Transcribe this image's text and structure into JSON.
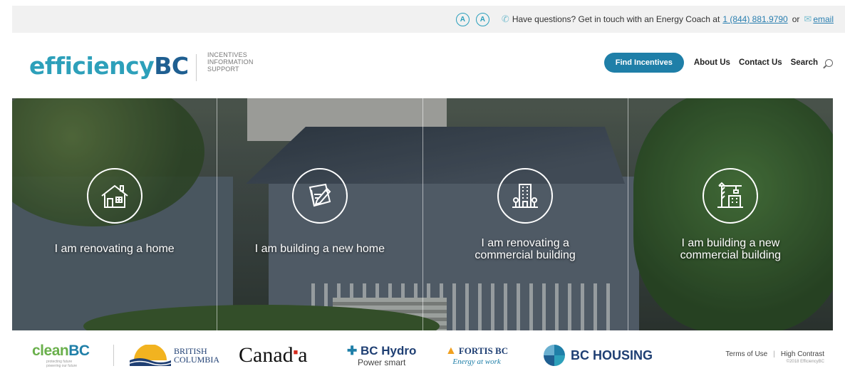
{
  "utility_bar": {
    "a11y_increase": "A",
    "a11y_decrease": "A",
    "question_text": "Have questions? Get in touch with an Energy Coach at",
    "phone": "1 (844) 881.9790",
    "or": "or",
    "email": "email"
  },
  "header": {
    "logo_part1": "efficiency",
    "logo_part2": "BC",
    "tagline": [
      "INCENTIVES",
      "INFORMATION",
      "SUPPORT"
    ],
    "nav": {
      "find_incentives": "Find Incentives",
      "about": "About Us",
      "contact": "Contact Us",
      "search": "Search"
    }
  },
  "hero": {
    "panels": [
      {
        "label": "I am renovating a home",
        "icon": "house-renovation-icon"
      },
      {
        "label": "I am building a new home",
        "icon": "blueprint-pencil-icon"
      },
      {
        "label_line1": "I am renovating a",
        "label_line2": "commercial building",
        "icon": "office-building-icon"
      },
      {
        "label_line1": "I am building a new",
        "label_line2": "commercial building",
        "icon": "crane-building-icon"
      }
    ]
  },
  "footer": {
    "partners": {
      "cleanbc": {
        "clean": "cl",
        "e": "ean",
        "bc": "BC",
        "sub": [
          "protecting future",
          "powering our future"
        ]
      },
      "bcgov": {
        "line1": "BRITISH",
        "line2": "COLUMBIA"
      },
      "canada": "Canad",
      "canada_end": "a",
      "bchydro": {
        "main": "BC Hydro",
        "sub": "Power smart"
      },
      "fortis": {
        "main": "FORTIS BC",
        "sub": "Energy at work"
      },
      "bchousing": "BC HOUSING"
    },
    "links": {
      "terms": "Terms of Use",
      "divider": "|",
      "contrast": "High Contrast",
      "copyright": "©2018 EfficiencyBC"
    }
  }
}
